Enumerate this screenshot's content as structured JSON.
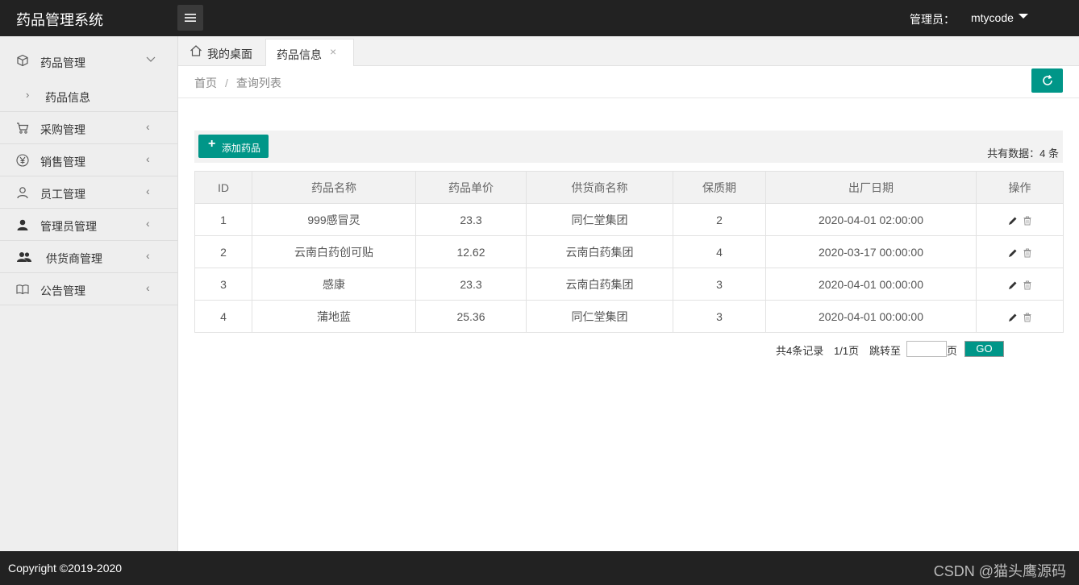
{
  "app": {
    "title": "药品管理系统",
    "admin_label": "管理员：",
    "admin_name": "mtycode"
  },
  "sidebar": {
    "items": [
      {
        "label": "药品管理",
        "icon": "cube-icon",
        "expanded": true,
        "children": [
          {
            "label": "药品信息"
          }
        ]
      },
      {
        "label": "采购管理",
        "icon": "cart-icon"
      },
      {
        "label": "销售管理",
        "icon": "yen-icon"
      },
      {
        "label": "员工管理",
        "icon": "user-icon"
      },
      {
        "label": "管理员管理",
        "icon": "admin-user-icon"
      },
      {
        "label": "供货商管理",
        "icon": "group-users-icon"
      },
      {
        "label": "公告管理",
        "icon": "book-icon"
      }
    ]
  },
  "tabs": [
    {
      "label": "我的桌面",
      "icon": "home-icon"
    },
    {
      "label": "药品信息",
      "close": "×"
    }
  ],
  "breadcrumb": {
    "home": "首页",
    "separator": "/",
    "current": "查询列表"
  },
  "toolbar": {
    "add_label": "添加药品",
    "total_text": "共有数据：4 条"
  },
  "table": {
    "headers": [
      "ID",
      "药品名称",
      "药品单价",
      "供货商名称",
      "保质期",
      "出厂日期",
      "操作"
    ],
    "rows": [
      [
        "1",
        "999感冒灵",
        "23.3",
        "同仁堂集团",
        "2",
        "2020-04-01 02:00:00"
      ],
      [
        "2",
        "云南白药创可贴",
        "12.62",
        "云南白药集团",
        "4",
        "2020-03-17 00:00:00"
      ],
      [
        "3",
        "感康",
        "23.3",
        "云南白药集团",
        "3",
        "2020-04-01 00:00:00"
      ],
      [
        "4",
        "蒲地蓝",
        "25.36",
        "同仁堂集团",
        "3",
        "2020-04-01 00:00:00"
      ]
    ]
  },
  "pager": {
    "records": "共4条记录",
    "pages": "1/1页",
    "jump_label": "跳转至",
    "page_unit": "页",
    "go_label": "GO",
    "jump_value": ""
  },
  "footer": {
    "copyright": "Copyright ©2019-2020",
    "watermark": "CSDN @猫头鹰源码"
  },
  "colors": {
    "accent": "#009688",
    "topbar": "#222222",
    "sidebar": "#eeeeee"
  }
}
